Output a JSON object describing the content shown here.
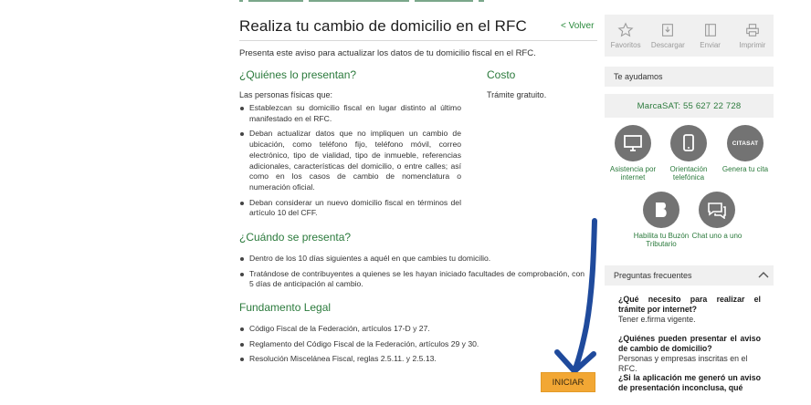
{
  "header": {
    "title": "Realiza tu cambio de domicilio en el RFC",
    "back_label": "< Volver",
    "intro": "Presenta este aviso para actualizar los datos de tu domicilio fiscal en el RFC."
  },
  "quienes": {
    "title": "¿Quiénes lo presentan?",
    "subtitle": "Las personas físicas que:",
    "items": [
      "Establezcan su domicilio fiscal en lugar distinto al último manifestado en el RFC.",
      "Deban actualizar datos que no impliquen un cambio de ubicación, como teléfono fijo, teléfono móvil, correo electrónico, tipo de vialidad, tipo de inmueble, referencias adicionales, características del domicilio, o entre calles; así como en los casos de cambio de nomenclatura o numeración oficial.",
      "Deban considerar un nuevo domicilio fiscal en términos del artículo 10 del CFF."
    ]
  },
  "costo": {
    "title": "Costo",
    "text": "Trámite gratuito."
  },
  "cuando": {
    "title": "¿Cuándo se presenta?",
    "items": [
      "Dentro de los 10 días siguientes a aquél en que cambies tu domicilio.",
      "Tratándose de contribuyentes a quienes se les hayan iniciado facultades de comprobación, con 5 días de anticipación al cambio."
    ]
  },
  "fundamento": {
    "title": "Fundamento Legal",
    "items": [
      "Código Fiscal de la Federación, artículos 17-D y 27.",
      "Reglamento del Código Fiscal de la Federación, artículos 29 y 30.",
      "Resolución Miscelánea Fiscal, reglas 2.5.11. y 2.5.13."
    ]
  },
  "action": {
    "start_label": "INICIAR",
    "accent": "#f2a734"
  },
  "toolbar": {
    "favorites": "Favoritos",
    "download": "Descargar",
    "send": "Enviar",
    "print": "Imprimir"
  },
  "help": {
    "title": "Te ayudamos",
    "phone": "MarcaSAT: 55 627 22 728",
    "options": [
      {
        "label": "Asistencia por internet",
        "icon": "monitor-icon"
      },
      {
        "label": "Orientación telefónica",
        "icon": "phone-icon"
      },
      {
        "label": "Genera tu cita",
        "icon": "citasat-icon"
      },
      {
        "label": "Habilita tu Buzón Tributario",
        "icon": "buzon-icon"
      },
      {
        "label": "Chat uno a uno",
        "icon": "chat-icon"
      }
    ],
    "citasat_logo": "CITASAT"
  },
  "faq": {
    "title": "Preguntas frecuentes",
    "items": [
      {
        "q": "¿Qué necesito para realizar el trámite por internet?",
        "a": "Tener e.firma vigente."
      },
      {
        "q": "¿Quiénes pueden presentar el aviso de cambio de domicilio?",
        "a": "Personas y empresas inscritas en el RFC."
      },
      {
        "q": "¿Si la aplicación me generó un aviso de presentación inconclusa, qué",
        "a": ""
      }
    ]
  },
  "colors": {
    "green": "#2b7a3c",
    "panel_bg": "#f0f0f0",
    "arrow": "#1f4a9c"
  }
}
